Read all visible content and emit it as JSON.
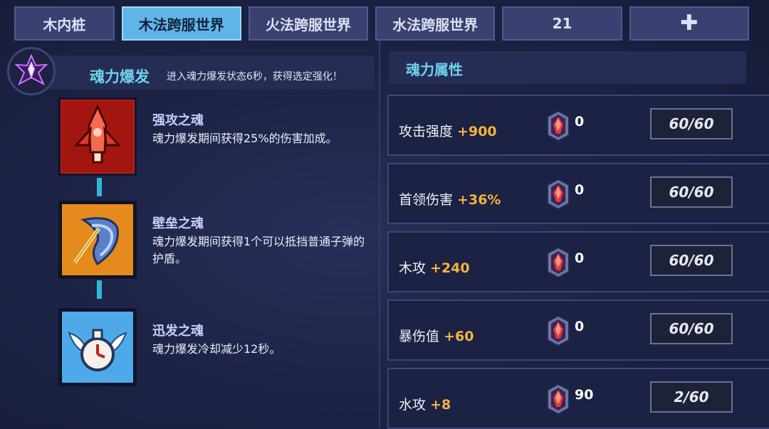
{
  "tabs": [
    {
      "label": "木内桩",
      "active": false
    },
    {
      "label": "木法跨服世界",
      "active": true
    },
    {
      "label": "火法跨服世界",
      "active": false
    },
    {
      "label": "水法跨服世界",
      "active": false
    },
    {
      "label": "21",
      "active": false
    },
    {
      "label": "✚",
      "active": false
    }
  ],
  "soul_burst": {
    "title": "魂力爆发",
    "description": "进入魂力爆发状态6秒，获得选定强化！",
    "icon": "purple-soul-crystal-icon"
  },
  "skills": [
    {
      "name": "强攻之魂",
      "description": "魂力爆发期间获得25%的伤害加成。",
      "icon": "red-rocket-soul-icon",
      "color": "#c8231c"
    },
    {
      "name": "壁垒之魂",
      "description": "魂力爆发期间获得1个可以抵挡普通子弹的护盾。",
      "icon": "orange-shield-soul-icon",
      "color": "#e3861a"
    },
    {
      "name": "迅发之魂",
      "description": "魂力爆发冷却减少12秒。",
      "icon": "blue-winged-clock-soul-icon",
      "color": "#4aa6e6"
    }
  ],
  "attributes": {
    "title": "魂力属性",
    "gem_icon": "red-soul-gem-icon",
    "rows": [
      {
        "label": "攻击强度",
        "bonus": "+900",
        "gems": "0",
        "progress": "60/60"
      },
      {
        "label": "首领伤害",
        "bonus": "+36%",
        "gems": "0",
        "progress": "60/60"
      },
      {
        "label": "木攻",
        "bonus": "+240",
        "gems": "0",
        "progress": "60/60"
      },
      {
        "label": "暴伤值",
        "bonus": "+60",
        "gems": "0",
        "progress": "60/60"
      },
      {
        "label": "水攻",
        "bonus": "+8",
        "gems": "90",
        "progress": "2/60"
      }
    ]
  },
  "colors": {
    "accent": "#6fd2ee",
    "bonus": "#f3b33d",
    "active_tab": "#5fb4e8"
  }
}
